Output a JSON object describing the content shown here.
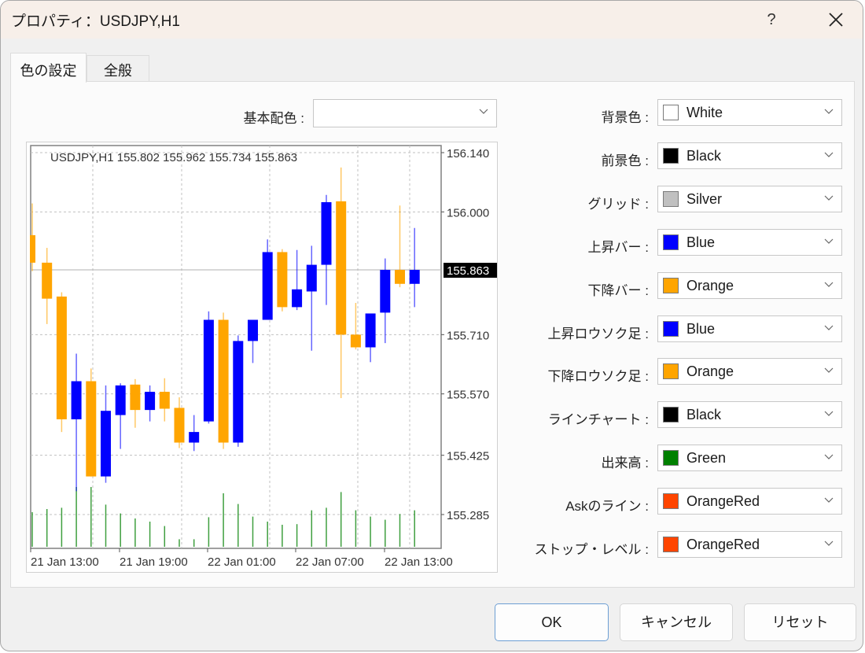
{
  "window": {
    "title": "プロパティ：USDJPY,H1",
    "help_label": "?",
    "close_icon": "close-icon"
  },
  "tabs": [
    {
      "label": "色の設定",
      "active": true
    },
    {
      "label": "全般",
      "active": false
    }
  ],
  "scheme": {
    "label": "基本配色 :",
    "value": ""
  },
  "color_settings": [
    {
      "label": "背景色 :",
      "value": "White",
      "color": "#ffffff"
    },
    {
      "label": "前景色 :",
      "value": "Black",
      "color": "#000000"
    },
    {
      "label": "グリッド :",
      "value": "Silver",
      "color": "#c0c0c0"
    },
    {
      "label": "上昇バー :",
      "value": "Blue",
      "color": "#0000ff"
    },
    {
      "label": "下降バー :",
      "value": "Orange",
      "color": "#ffa500"
    },
    {
      "label": "上昇ロウソク足 :",
      "value": "Blue",
      "color": "#0000ff"
    },
    {
      "label": "下降ロウソク足 :",
      "value": "Orange",
      "color": "#ffa500"
    },
    {
      "label": "ラインチャート :",
      "value": "Black",
      "color": "#000000"
    },
    {
      "label": "出来高 :",
      "value": "Green",
      "color": "#008000"
    },
    {
      "label": "Askのライン :",
      "value": "OrangeRed",
      "color": "#ff4500"
    },
    {
      "label": "ストップ・レベル :",
      "value": "OrangeRed",
      "color": "#ff4500"
    }
  ],
  "buttons": {
    "ok": "OK",
    "cancel": "キャンセル",
    "reset": "リセット"
  },
  "chart_data": {
    "type": "candlestick",
    "title": "USDJPY,H1  155.802 155.962 155.734 155.863",
    "symbol": "USDJPY,H1",
    "ohlc_header": [
      "155.802",
      "155.962",
      "155.734",
      "155.863"
    ],
    "current_price": "155.863",
    "y_ticks": [
      "156.140",
      "156.000",
      "155.710",
      "155.570",
      "155.425",
      "155.285"
    ],
    "x_ticks": [
      "21 Jan 13:00",
      "21 Jan 19:00",
      "22 Jan 01:00",
      "22 Jan 07:00",
      "22 Jan 13:00"
    ],
    "ylim": [
      155.21,
      156.15
    ],
    "grid": true,
    "up_color": "#0000ff",
    "down_color": "#ffa500",
    "volume_color": "#008000",
    "candles": [
      {
        "o": 155.945,
        "h": 156.02,
        "l": 155.86,
        "c": 155.88
      },
      {
        "o": 155.88,
        "h": 155.915,
        "l": 155.735,
        "c": 155.795
      },
      {
        "o": 155.8,
        "h": 155.81,
        "l": 155.48,
        "c": 155.51
      },
      {
        "o": 155.51,
        "h": 155.665,
        "l": 155.34,
        "c": 155.6
      },
      {
        "o": 155.6,
        "h": 155.63,
        "l": 155.375,
        "c": 155.375
      },
      {
        "o": 155.375,
        "h": 155.59,
        "l": 155.36,
        "c": 155.53
      },
      {
        "o": 155.52,
        "h": 155.595,
        "l": 155.44,
        "c": 155.59
      },
      {
        "o": 155.592,
        "h": 155.605,
        "l": 155.49,
        "c": 155.532
      },
      {
        "o": 155.532,
        "h": 155.59,
        "l": 155.505,
        "c": 155.575
      },
      {
        "o": 155.575,
        "h": 155.607,
        "l": 155.505,
        "c": 155.535
      },
      {
        "o": 155.537,
        "h": 155.562,
        "l": 155.442,
        "c": 155.455
      },
      {
        "o": 155.455,
        "h": 155.52,
        "l": 155.435,
        "c": 155.48
      },
      {
        "o": 155.505,
        "h": 155.765,
        "l": 155.5,
        "c": 155.745
      },
      {
        "o": 155.745,
        "h": 155.762,
        "l": 155.44,
        "c": 155.455
      },
      {
        "o": 155.455,
        "h": 155.708,
        "l": 155.445,
        "c": 155.695
      },
      {
        "o": 155.695,
        "h": 155.733,
        "l": 155.643,
        "c": 155.745
      },
      {
        "o": 155.745,
        "h": 155.935,
        "l": 155.745,
        "c": 155.905
      },
      {
        "o": 155.905,
        "h": 155.912,
        "l": 155.765,
        "c": 155.775
      },
      {
        "o": 155.775,
        "h": 155.91,
        "l": 155.768,
        "c": 155.817
      },
      {
        "o": 155.812,
        "h": 155.92,
        "l": 155.672,
        "c": 155.875
      },
      {
        "o": 155.875,
        "h": 156.04,
        "l": 155.78,
        "c": 156.023
      },
      {
        "o": 156.025,
        "h": 156.105,
        "l": 155.56,
        "c": 155.71
      },
      {
        "o": 155.71,
        "h": 155.785,
        "l": 155.675,
        "c": 155.68
      },
      {
        "o": 155.68,
        "h": 155.745,
        "l": 155.645,
        "c": 155.76
      },
      {
        "o": 155.762,
        "h": 155.89,
        "l": 155.69,
        "c": 155.863
      },
      {
        "o": 155.863,
        "h": 156.015,
        "l": 155.822,
        "c": 155.83
      },
      {
        "o": 155.83,
        "h": 155.962,
        "l": 155.775,
        "c": 155.863
      }
    ],
    "volumes": [
      0.55,
      0.6,
      0.62,
      0.95,
      0.95,
      0.67,
      0.53,
      0.45,
      0.4,
      0.33,
      0.12,
      0.12,
      0.47,
      0.85,
      0.68,
      0.48,
      0.4,
      0.35,
      0.36,
      0.58,
      0.62,
      0.87,
      0.58,
      0.48,
      0.43,
      0.52,
      0.58
    ]
  }
}
